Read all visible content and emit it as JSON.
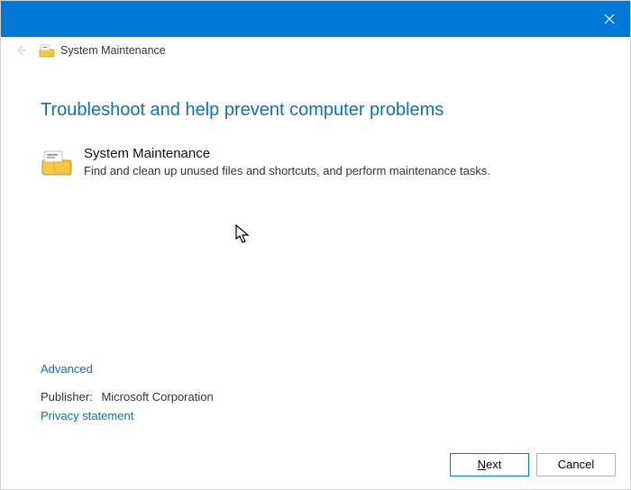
{
  "titlebar": {
    "close_tooltip": "Close"
  },
  "header": {
    "title": "System Maintenance"
  },
  "main": {
    "heading": "Troubleshoot and help prevent computer problems",
    "item_title": "System Maintenance",
    "item_desc": "Find and clean up unused files and shortcuts, and perform maintenance tasks."
  },
  "links": {
    "advanced": "Advanced",
    "privacy": "Privacy statement"
  },
  "publisher": {
    "label": "Publisher:",
    "value": "Microsoft Corporation"
  },
  "buttons": {
    "next_pre": "N",
    "next_post": "ext",
    "cancel": "Cancel"
  }
}
